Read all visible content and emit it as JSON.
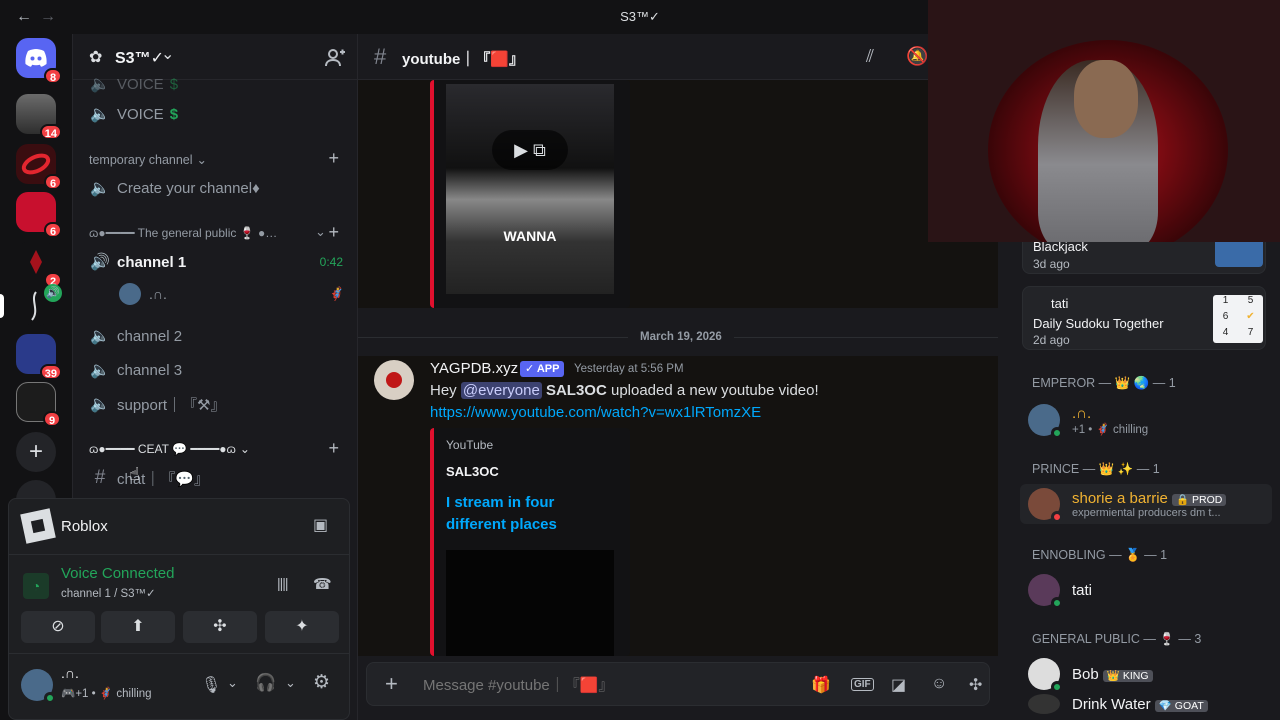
{
  "window": {
    "title": "S3™✓",
    "back": "←",
    "forward": "→"
  },
  "servers": [
    {
      "badge": "8",
      "name": "discord-home"
    },
    {
      "badge": "14"
    },
    {
      "badge": "6"
    },
    {
      "badge": "6"
    },
    {
      "badge": "2"
    },
    {
      "badge": ""
    },
    {
      "badge": "39"
    },
    {
      "badge": "9"
    }
  ],
  "server": {
    "name": "S3™✓",
    "chevron": "⌄"
  },
  "channels": {
    "voice_partial": "VOICE",
    "voice": "VOICE",
    "dollar": "$",
    "cat_temporary": "temporary channel",
    "create": "Create your channel♦",
    "cat_general": "ɷ●━━━━ The general public 🍷 ●…",
    "channel1": "channel 1",
    "channel1_time": "0:42",
    "channel1_user": ".∩.",
    "channel2": "channel 2",
    "channel3": "channel 3",
    "support": "support｜『⚒』",
    "cat_ceat": "ɷ●━━━━ CEAT 💬 ━━━━●ɷ",
    "chat": "chat｜『💬』"
  },
  "activity": {
    "game": "Roblox"
  },
  "voice": {
    "status": "Voice Connected",
    "location": "channel 1 / S3™✓"
  },
  "user": {
    "name": ".∩.",
    "plus": "+1",
    "status": "chilling"
  },
  "chat": {
    "channel": "youtube｜『🟥』",
    "embed1_caption": "WANNA",
    "date_divider": "March 19, 2026",
    "author": "YAGPDB.xyz",
    "app_tag": "✓ APP",
    "timestamp": "Yesterday at 5:56 PM",
    "msg_hey": "Hey",
    "mention": "@everyone",
    "msg_name": "SAL3OC",
    "msg_rest": "uploaded a new youtube video!",
    "link": "https://www.youtube.com/watch?v=wx1lRTomzXE",
    "embed_provider": "YouTube",
    "embed_author": "SAL3OC",
    "embed_title": "I stream in four different places",
    "placeholder": "Message #youtube｜『🟥』"
  },
  "members": {
    "activity1_title": "Blackjack",
    "activity1_time": "3d ago",
    "activity2_user": "tati",
    "activity2_title": "Daily Sudoku Together",
    "activity2_time": "2d ago",
    "sudoku_digits": [
      "1",
      "5",
      "6",
      "4",
      "7"
    ],
    "cat_emperor": "EMPEROR — 👑 🌏 — 1",
    "emperor_name": ".∩.",
    "emperor_sub": "+1 • 🦸 chilling",
    "cat_prince": "PRINCE — 👑 ✨ — 1",
    "prince_name": "shorie a barrie",
    "prince_tag": "🔒 PROD",
    "prince_sub": "expermiental producers dm t...",
    "cat_ennobling": "ENNOBLING — 🏅 — 1",
    "ennobling_name": "tati",
    "cat_public": "GENERAL PUBLIC — 🍷 — 3",
    "public1_name": "Bob",
    "public1_tag": "👑 KING",
    "public2_name": "Drink Water",
    "public2_tag": "💎 GOAT"
  },
  "colors": {
    "accent": "#5865f2",
    "green": "#23a55a",
    "red": "#f23f43",
    "link": "#00a8fc",
    "mention_bg": "#3c4270",
    "embed_bar": "#e0102e"
  }
}
